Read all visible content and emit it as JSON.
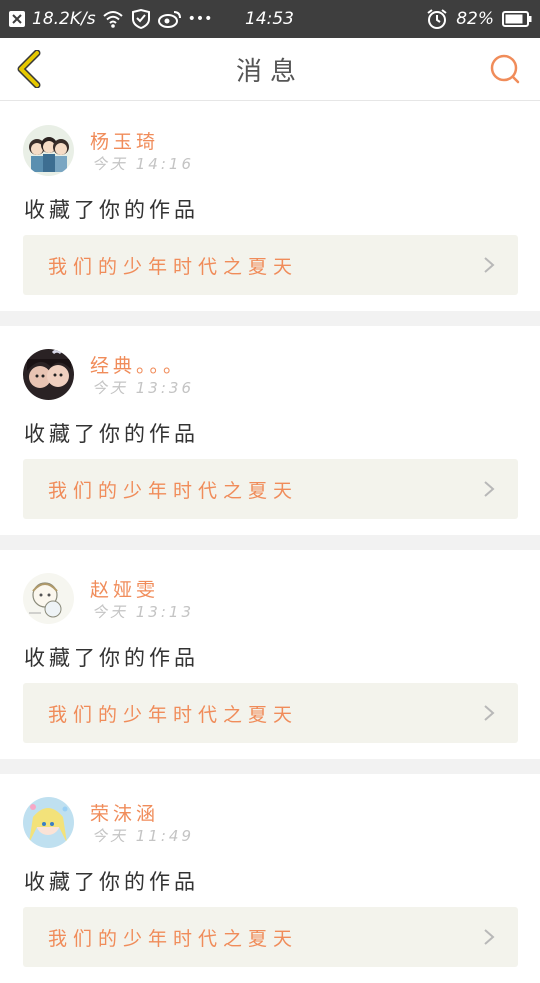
{
  "status_bar": {
    "net_speed": "18.2K/s",
    "more": "•••",
    "time": "14:53",
    "battery": "82%"
  },
  "nav": {
    "title": "消息"
  },
  "colors": {
    "accent": "#f08c5a",
    "status_bar_bg": "#3e3e3e",
    "card_work_bg": "#f3f3ec",
    "back_arrow": "#d4b400"
  },
  "messages": [
    {
      "user": "杨玉琦",
      "time": "今天 14:16",
      "action": "收藏了你的作品",
      "work_title": "我们的少年时代之夏天",
      "avatar_icon": "avatar-cartoon-group"
    },
    {
      "user": "经典。。。",
      "time": "今天 13:36",
      "action": "收藏了你的作品",
      "work_title": "我们的少年时代之夏天",
      "avatar_icon": "avatar-photo"
    },
    {
      "user": "赵娅雯",
      "time": "今天 13:13",
      "action": "收藏了你的作品",
      "work_title": "我们的少年时代之夏天",
      "avatar_icon": "avatar-sketch"
    },
    {
      "user": "荣沫涵",
      "time": "今天 11:49",
      "action": "收藏了你的作品",
      "work_title": "我们的少年时代之夏天",
      "avatar_icon": "avatar-anime-girl"
    }
  ]
}
